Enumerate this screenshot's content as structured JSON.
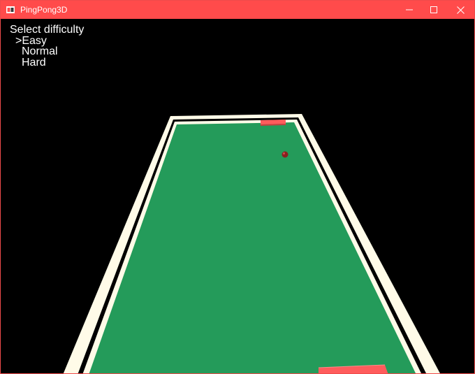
{
  "window": {
    "title": "PingPong3D",
    "accent_color": "#ff4b4b",
    "controls": [
      "minimize-icon",
      "maximize-icon",
      "close-icon"
    ]
  },
  "menu": {
    "title": "Select difficulty",
    "options": [
      {
        "label": ">Easy",
        "selected": true
      },
      {
        "label": "Normal",
        "selected": false
      },
      {
        "label": "Hard",
        "selected": false
      }
    ]
  },
  "scene": {
    "table_color": "#249b5a",
    "rail_color": "#fffbe8",
    "paddle_color": "#ff5c5c",
    "ball_color": "#8a1f1f"
  }
}
